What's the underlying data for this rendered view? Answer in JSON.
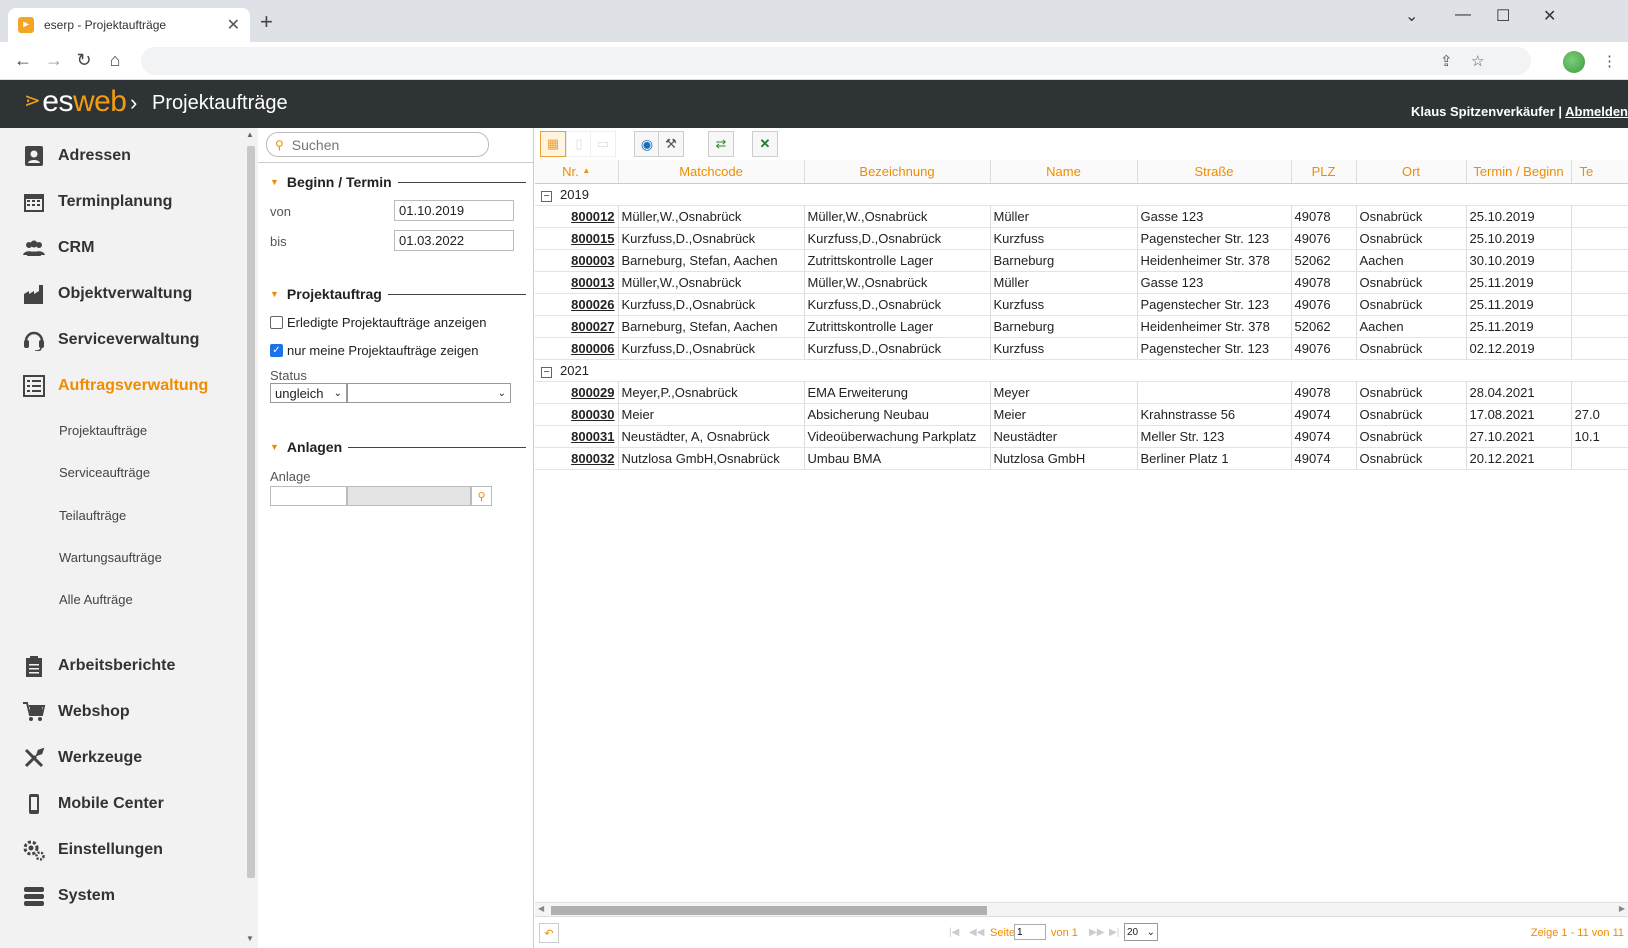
{
  "browser": {
    "tab_title": "eserp - Projektaufträge",
    "tab_close": "✕",
    "new_tab": "+"
  },
  "header": {
    "logo_es": "es",
    "logo_web": "web",
    "breadcrumb": "Projektaufträge",
    "user": "Klaus Spitzenverkäufer",
    "separator": " | ",
    "logout": "Abmelden"
  },
  "sidebar": {
    "items": [
      {
        "label": "Adressen",
        "icon": "address-book-icon"
      },
      {
        "label": "Terminplanung",
        "icon": "calendar-icon"
      },
      {
        "label": "CRM",
        "icon": "people-icon"
      },
      {
        "label": "Objektverwaltung",
        "icon": "factory-icon"
      },
      {
        "label": "Serviceverwaltung",
        "icon": "headset-icon"
      },
      {
        "label": "Auftragsverwaltung",
        "icon": "list-icon"
      },
      {
        "label": "Arbeitsberichte",
        "icon": "clipboard-icon"
      },
      {
        "label": "Webshop",
        "icon": "cart-icon"
      },
      {
        "label": "Werkzeuge",
        "icon": "tools-icon"
      },
      {
        "label": "Mobile Center",
        "icon": "mobile-icon"
      },
      {
        "label": "Einstellungen",
        "icon": "gears-icon"
      },
      {
        "label": "System",
        "icon": "server-icon"
      }
    ],
    "subitems": [
      "Projektaufträge",
      "Serviceaufträge",
      "Teilaufträge",
      "Wartungsaufträge",
      "Alle Aufträge"
    ]
  },
  "filter": {
    "search_placeholder": "Suchen",
    "section1": "Beginn / Termin",
    "von_label": "von",
    "von_value": "01.10.2019",
    "bis_label": "bis",
    "bis_value": "01.03.2022",
    "section2": "Projektauftrag",
    "chk1_label": "Erledigte Projektaufträge anzeigen",
    "chk1_checked": false,
    "chk2_label": "nur meine Projektaufträge zeigen",
    "chk2_checked": true,
    "status_label": "Status",
    "status_op": "ungleich",
    "status_value": "",
    "section3": "Anlagen",
    "anlage_label": "Anlage"
  },
  "grid": {
    "columns": [
      "Nr.",
      "Matchcode",
      "Bezeichnung",
      "Name",
      "Straße",
      "PLZ",
      "Ort",
      "Termin / Beginn",
      "Te"
    ],
    "sort_indicator": "▲",
    "groups": [
      {
        "label": "2019",
        "rows": [
          {
            "nr": "800012",
            "matchcode": "Müller,W.,Osnabrück",
            "bezeichnung": "Müller,W.,Osnabrück",
            "name": "Müller",
            "strasse": "Gasse 123",
            "plz": "49078",
            "ort": "Osnabrück",
            "termin": "25.10.2019",
            "te": ""
          },
          {
            "nr": "800015",
            "matchcode": "Kurzfuss,D.,Osnabrück",
            "bezeichnung": "Kurzfuss,D.,Osnabrück",
            "name": "Kurzfuss",
            "strasse": "Pagenstecher Str. 123",
            "plz": "49076",
            "ort": "Osnabrück",
            "termin": "25.10.2019",
            "te": ""
          },
          {
            "nr": "800003",
            "matchcode": "Barneburg, Stefan, Aachen",
            "bezeichnung": "Zutrittskontrolle Lager",
            "name": "Barneburg",
            "strasse": "Heidenheimer Str. 378",
            "plz": "52062",
            "ort": "Aachen",
            "termin": "30.10.2019",
            "te": ""
          },
          {
            "nr": "800013",
            "matchcode": "Müller,W.,Osnabrück",
            "bezeichnung": "Müller,W.,Osnabrück",
            "name": "Müller",
            "strasse": "Gasse 123",
            "plz": "49078",
            "ort": "Osnabrück",
            "termin": "25.11.2019",
            "te": ""
          },
          {
            "nr": "800026",
            "matchcode": "Kurzfuss,D.,Osnabrück",
            "bezeichnung": "Kurzfuss,D.,Osnabrück",
            "name": "Kurzfuss",
            "strasse": "Pagenstecher Str. 123",
            "plz": "49076",
            "ort": "Osnabrück",
            "termin": "25.11.2019",
            "te": ""
          },
          {
            "nr": "800027",
            "matchcode": "Barneburg, Stefan, Aachen",
            "bezeichnung": "Zutrittskontrolle Lager",
            "name": "Barneburg",
            "strasse": "Heidenheimer Str. 378",
            "plz": "52062",
            "ort": "Aachen",
            "termin": "25.11.2019",
            "te": ""
          },
          {
            "nr": "800006",
            "matchcode": "Kurzfuss,D.,Osnabrück",
            "bezeichnung": "Kurzfuss,D.,Osnabrück",
            "name": "Kurzfuss",
            "strasse": "Pagenstecher Str. 123",
            "plz": "49076",
            "ort": "Osnabrück",
            "termin": "02.12.2019",
            "te": ""
          }
        ]
      },
      {
        "label": "2021",
        "rows": [
          {
            "nr": "800029",
            "matchcode": "Meyer,P.,Osnabrück",
            "bezeichnung": "EMA Erweiterung",
            "name": "Meyer",
            "strasse": "",
            "plz": "49078",
            "ort": "Osnabrück",
            "termin": "28.04.2021",
            "te": ""
          },
          {
            "nr": "800030",
            "matchcode": "Meier",
            "bezeichnung": "Absicherung Neubau",
            "name": "Meier",
            "strasse": "Krahnstrasse 56",
            "plz": "49074",
            "ort": "Osnabrück",
            "termin": "17.08.2021",
            "te": "27.0"
          },
          {
            "nr": "800031",
            "matchcode": "Neustädter, A, Osnabrück",
            "bezeichnung": "Videoüberwachung Parkplatz",
            "name": "Neustädter",
            "strasse": "Meller Str. 123",
            "plz": "49074",
            "ort": "Osnabrück",
            "termin": "27.10.2021",
            "te": "10.1"
          },
          {
            "nr": "800032",
            "matchcode": "Nutzlosa GmbH,Osnabrück",
            "bezeichnung": "Umbau BMA",
            "name": "Nutzlosa GmbH",
            "strasse": "Berliner Platz 1",
            "plz": "49074",
            "ort": "Osnabrück",
            "termin": "20.12.2021",
            "te": ""
          }
        ]
      }
    ]
  },
  "pager": {
    "seite_label": "Seite",
    "page_value": "1",
    "von_label": "von 1",
    "page_size": "20",
    "summary": "Zeige 1 - 11 von 11"
  },
  "colors": {
    "accent": "#f08c00",
    "header_bg": "#2e3436"
  }
}
